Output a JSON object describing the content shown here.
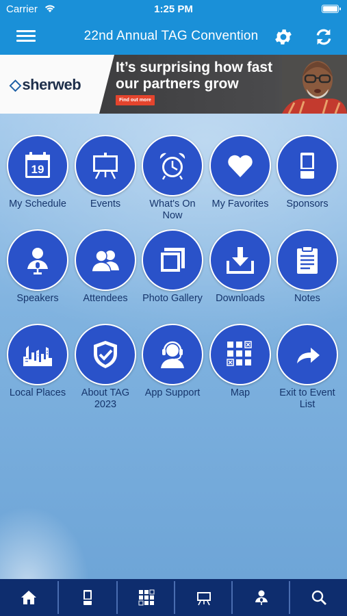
{
  "status": {
    "carrier": "Carrier",
    "time": "1:25 PM"
  },
  "header": {
    "title": "22nd Annual TAG Convention",
    "menu_icon": "hamburger-menu-icon",
    "settings_icon": "gear-icon",
    "refresh_icon": "refresh-icon"
  },
  "banner": {
    "logo": "sherweb",
    "headline_line1": "It’s surprising how fast",
    "headline_line2": "our partners grow",
    "cta": "Find out more"
  },
  "tiles": [
    {
      "label": "My Schedule",
      "icon": "calendar-icon"
    },
    {
      "label": "Events",
      "icon": "easel-icon"
    },
    {
      "label": "What's On Now",
      "icon": "alarm-clock-icon"
    },
    {
      "label": "My Favorites",
      "icon": "heart-icon"
    },
    {
      "label": "Sponsors",
      "icon": "booth-icon"
    },
    {
      "label": "Speakers",
      "icon": "speaker-icon"
    },
    {
      "label": "Attendees",
      "icon": "people-icon"
    },
    {
      "label": "Photo Gallery",
      "icon": "photos-icon"
    },
    {
      "label": "Downloads",
      "icon": "download-icon"
    },
    {
      "label": "Notes",
      "icon": "clipboard-icon"
    },
    {
      "label": "Local Places",
      "icon": "city-skyline-icon"
    },
    {
      "label": "About TAG 2023",
      "icon": "shield-check-icon"
    },
    {
      "label": "App Support",
      "icon": "headset-icon"
    },
    {
      "label": "Map",
      "icon": "map-grid-icon"
    },
    {
      "label": "Exit to Event List",
      "icon": "exit-arrow-icon"
    }
  ],
  "calendar_day": "19",
  "tabbar": [
    "home-icon",
    "booth-icon",
    "map-grid-icon",
    "easel-icon",
    "speaker-icon",
    "search-icon"
  ],
  "colors": {
    "bar": "#1a90d8",
    "tile": "#2a52c9",
    "tabbar": "#0e2d6e",
    "label": "#16356c",
    "cta": "#e4442d"
  }
}
